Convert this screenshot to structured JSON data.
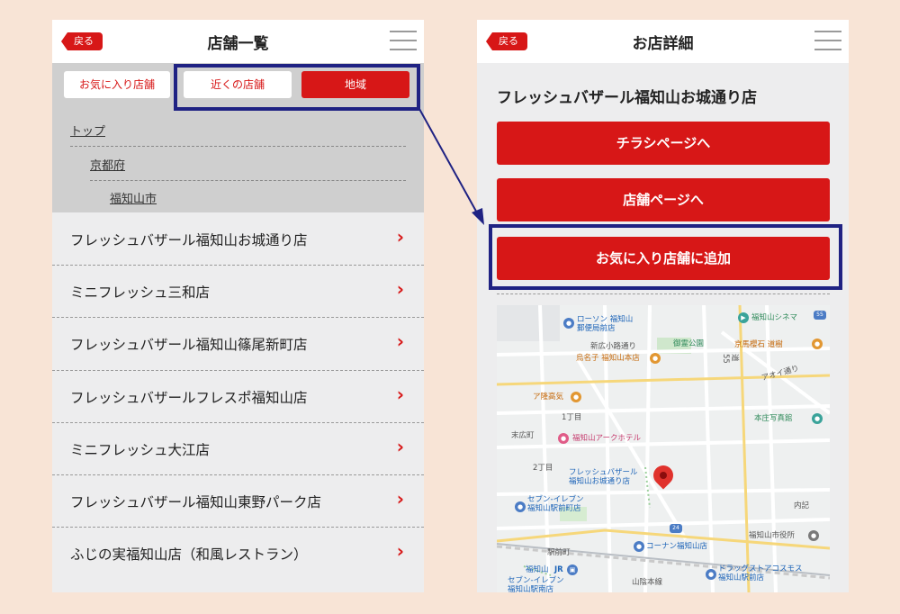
{
  "left": {
    "header": {
      "back_label": "戻る",
      "title": "店舗一覧"
    },
    "filters": {
      "favorites": "お気に入り店舗",
      "nearby": "近くの店舗",
      "region": "地域"
    },
    "breadcrumb": [
      "トップ",
      "京都府",
      "福知山市"
    ],
    "stores": [
      "フレッシュバザール福知山お城通り店",
      "ミニフレッシュ三和店",
      "フレッシュバザール福知山篠尾新町店",
      "フレッシュバザールフレスポ福知山店",
      "ミニフレッシュ大江店",
      "フレッシュバザール福知山東野パーク店",
      "ふじの実福知山店（和風レストラン）"
    ],
    "chevron": "›"
  },
  "right": {
    "header": {
      "back_label": "戻る",
      "title": "お店詳細"
    },
    "store_name": "フレッシュバザール福知山お城通り店",
    "buttons": {
      "flyer": "チラシページへ",
      "store_page": "店舗ページへ",
      "add_favorite": "お気に入り店舗に追加"
    },
    "map_labels": {
      "lawson": "ローソン 福知山\n郵便局前店",
      "cinema": "福知山シネマ",
      "new_road": "新広小路通り",
      "karasu": "烏名子 福知山本店",
      "park": "御霊公園",
      "kyouto_gem": "京馬櫻石 道樹",
      "aoi": "アオイ通り",
      "route": "道\n55",
      "ap": "ア隆高気",
      "itchome": "1丁目",
      "suehiro": "末広町",
      "hotel": "福知山アークホテル",
      "camera": "本庄写真館",
      "nichome": "2丁目",
      "store_pin": "フレッシュバザール\n福知山お城通り店",
      "seven1": "セブン-イレブン\n福知山駅前町店",
      "uchiki": "内記",
      "konan": "コーナン福知山店",
      "ekimae": "駅前町",
      "cityhall": "福知山市役所",
      "station": "福知山",
      "jr": "JR",
      "drug": "ドラッグストアコスモス\n福知山駅前店",
      "line": "山陰本線",
      "seven2": "セブン-イレブン\n福知山駅南店",
      "route24": "24",
      "route55": "55"
    }
  },
  "colors": {
    "brand_red": "#d71717",
    "highlight_navy": "#1f2283",
    "background": "#f8e4d6"
  }
}
